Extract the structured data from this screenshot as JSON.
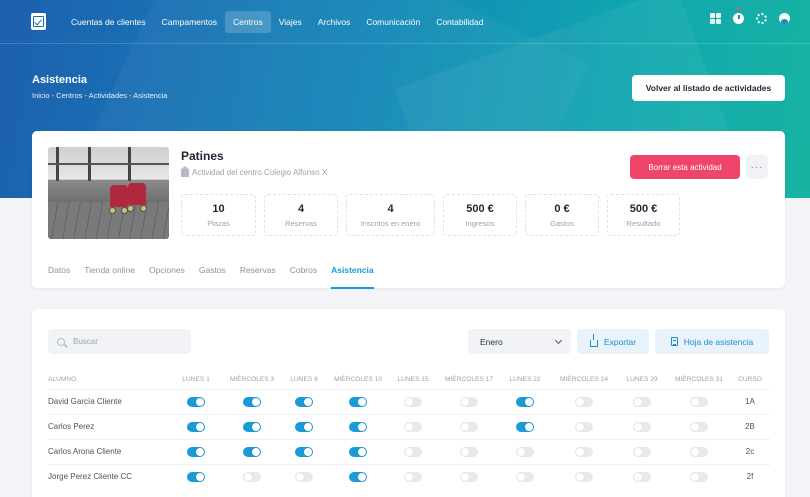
{
  "nav": {
    "menu": [
      {
        "label": "Cuentas de clientes",
        "active": false
      },
      {
        "label": "Campamentos",
        "active": false
      },
      {
        "label": "Centros",
        "active": true
      },
      {
        "label": "Viajes",
        "active": false
      },
      {
        "label": "Archivos",
        "active": false
      },
      {
        "label": "Comunicación",
        "active": false
      },
      {
        "label": "Contabilidad",
        "active": false
      }
    ],
    "icons": [
      "grid-icon",
      "clock-icon",
      "gear-icon",
      "user-icon"
    ]
  },
  "header": {
    "title": "Asistencia",
    "breadcrumb": "Inicio - Centros - Actividades - Asistencia",
    "back_button": "Volver al listado de actividades"
  },
  "activity": {
    "name": "Patines",
    "subtitle": "Actividad del centro Colegio Alfonso X",
    "delete_button": "Borrar esta actividad",
    "more_button": "···",
    "stats": [
      {
        "value": "10",
        "label": "Plazas"
      },
      {
        "value": "4",
        "label": "Reservas"
      },
      {
        "value": "4",
        "label": "Inscritos en enero"
      },
      {
        "value": "500 €",
        "label": "Ingresos"
      },
      {
        "value": "0 €",
        "label": "Gastos"
      },
      {
        "value": "500 €",
        "label": "Resultado"
      }
    ],
    "tabs": [
      {
        "label": "Datos",
        "active": false
      },
      {
        "label": "Tienda online",
        "active": false
      },
      {
        "label": "Opciones",
        "active": false
      },
      {
        "label": "Gastos",
        "active": false
      },
      {
        "label": "Reservas",
        "active": false
      },
      {
        "label": "Cobros",
        "active": false
      },
      {
        "label": "Asistencia",
        "active": true
      }
    ]
  },
  "attendance": {
    "search_placeholder": "Buscar",
    "month": "Enero",
    "export_button": "Exportar",
    "sheet_button": "Hoja de asistencia",
    "columns": {
      "student": "ALUMNO",
      "days": [
        "LUNES 1",
        "MIÉRCOLES 3",
        "LUNES 8",
        "MIÉRCOLES 10",
        "LUNES 15",
        "MIÉRCOLES 17",
        "LUNES 22",
        "MIÉRCOLES 24",
        "LUNES 29",
        "MIÉRCOLES 31"
      ],
      "course": "CURSO"
    },
    "rows": [
      {
        "name": "David García Cliente",
        "attendance": [
          true,
          true,
          true,
          true,
          false,
          false,
          true,
          false,
          false,
          false
        ],
        "course": "1A"
      },
      {
        "name": "Carlos Perez",
        "attendance": [
          true,
          true,
          true,
          true,
          false,
          false,
          true,
          false,
          false,
          false
        ],
        "course": "2B"
      },
      {
        "name": "Carlos Arona Cliente",
        "attendance": [
          true,
          true,
          true,
          true,
          false,
          false,
          false,
          false,
          false,
          false
        ],
        "course": "2c"
      },
      {
        "name": "Jorge Perez Cliente CC",
        "attendance": [
          true,
          false,
          false,
          true,
          false,
          false,
          false,
          false,
          false,
          false
        ],
        "course": "2f"
      }
    ]
  },
  "colors": {
    "accent": "#1b9ad8",
    "danger": "#f0456a",
    "hero_start": "#1d5fae",
    "hero_end": "#17b4a2"
  }
}
